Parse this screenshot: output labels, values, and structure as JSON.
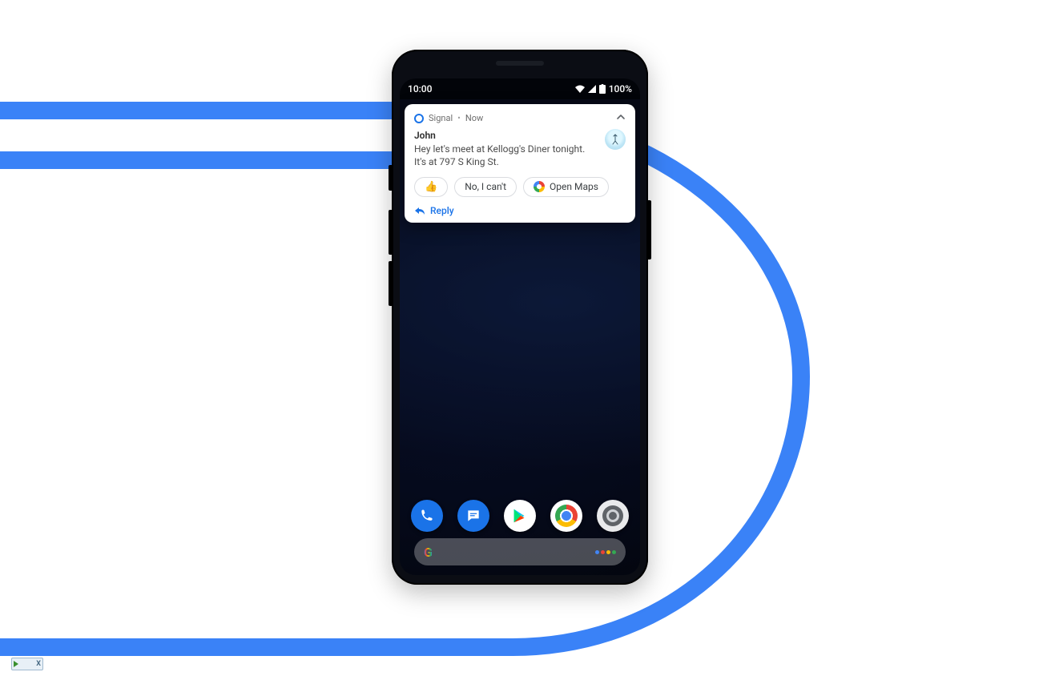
{
  "statusbar": {
    "time": "10:00",
    "battery": "100%"
  },
  "notification": {
    "app_name": "Signal",
    "when": "Now",
    "sender": "John",
    "message": "Hey let's meet at Kellogg's Diner tonight. It's at 797 S King St.",
    "reply_label": "Reply",
    "suggestions": {
      "thumbs": "👍",
      "decline": "No, I can't",
      "maps": "Open Maps"
    }
  },
  "dock": {
    "apps": [
      "phone",
      "messages",
      "play-store",
      "chrome",
      "camera"
    ]
  },
  "search": {
    "logo": "G"
  }
}
